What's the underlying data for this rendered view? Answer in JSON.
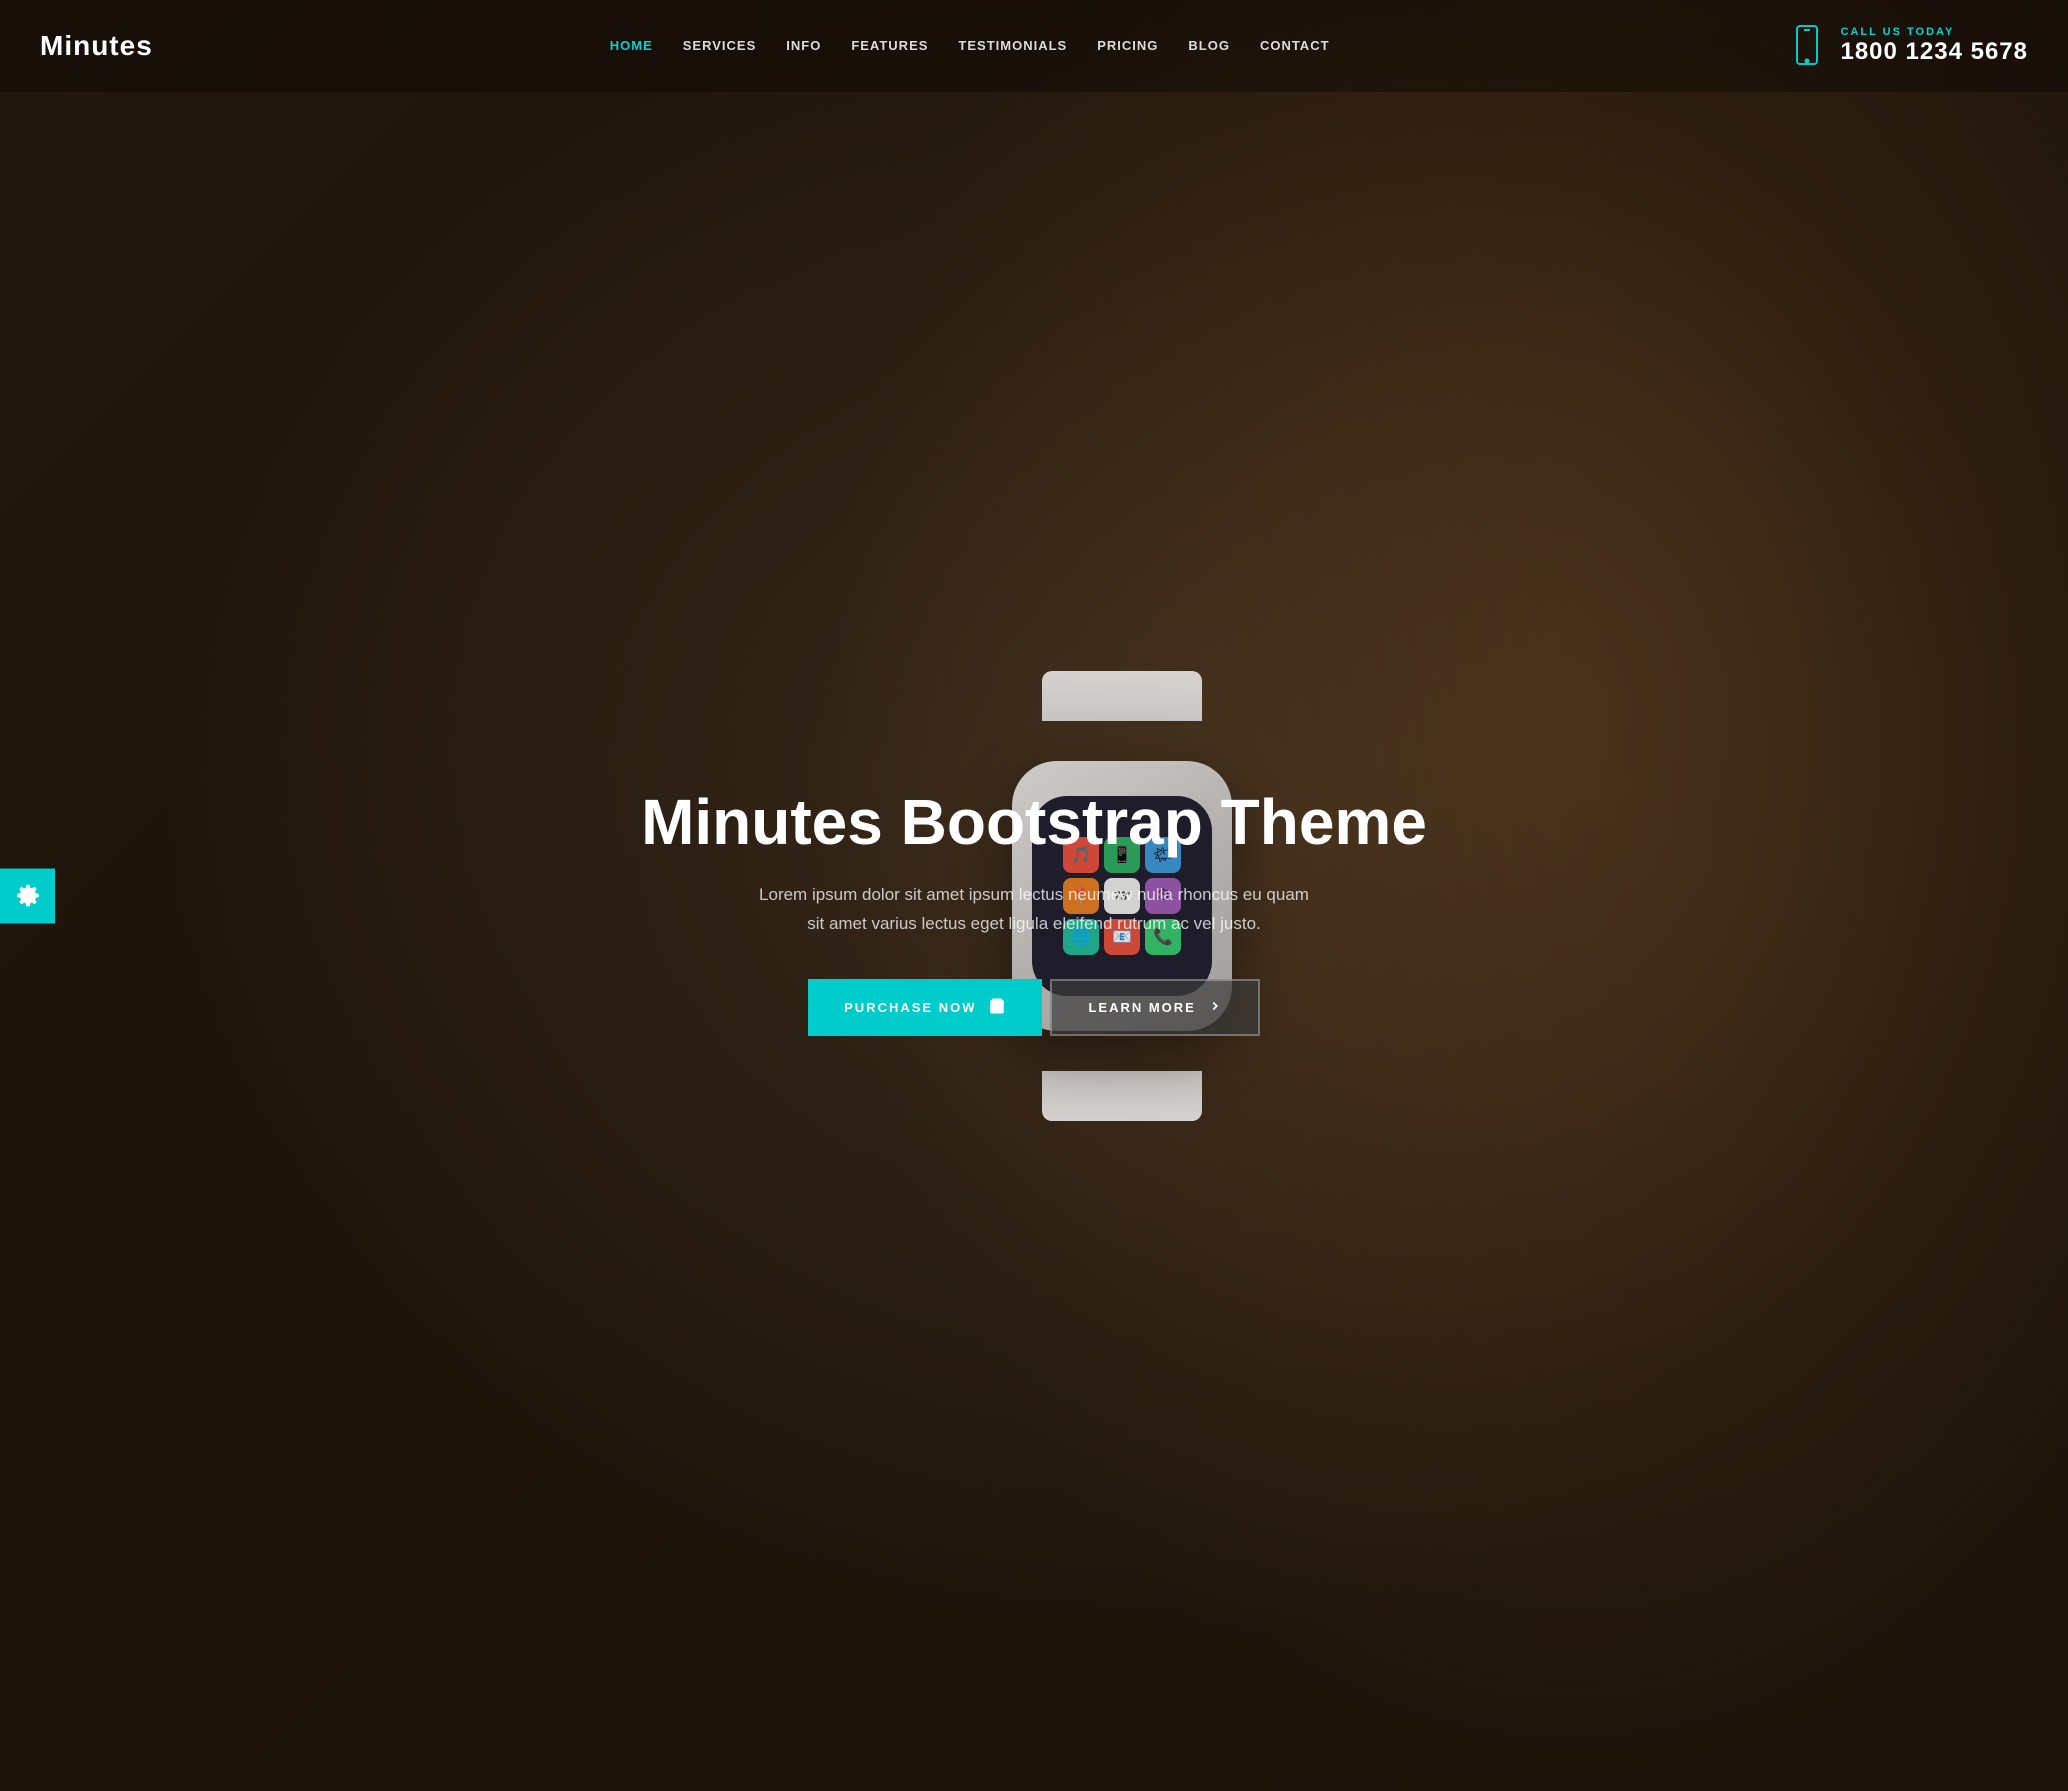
{
  "brand": {
    "name": "Minutes"
  },
  "navbar": {
    "links": [
      {
        "label": "HOME",
        "active": true,
        "href": "#home"
      },
      {
        "label": "SERVICES",
        "active": false,
        "href": "#services"
      },
      {
        "label": "INFO",
        "active": false,
        "href": "#info"
      },
      {
        "label": "FEATURES",
        "active": false,
        "href": "#features"
      },
      {
        "label": "TESTIMONIALS",
        "active": false,
        "href": "#testimonials"
      },
      {
        "label": "PRICING",
        "active": false,
        "href": "#pricing"
      },
      {
        "label": "BLOG",
        "active": false,
        "href": "#blog"
      },
      {
        "label": "CONTACT",
        "active": false,
        "href": "#contact"
      }
    ],
    "call_label": "CALL US TODAY",
    "phone_number": "1800 1234 5678"
  },
  "hero": {
    "title": "Minutes Bootstrap Theme",
    "description": "Lorem ipsum dolor sit amet ipsum lectus neumew nulla rhoncus eu quam sit amet varius lectus eget ligula eleifend rutrum ac vel justo.",
    "btn_purchase": "PURCHASE NOW",
    "btn_learn": "LEARN MORE"
  },
  "settings": {
    "icon": "gear"
  },
  "colors": {
    "accent": "#00cccc",
    "white": "#ffffff",
    "dark": "#1a1a1a"
  },
  "watch": {
    "apps": [
      {
        "color": "#e74c3c",
        "emoji": "🎵"
      },
      {
        "color": "#27ae60",
        "emoji": "📱"
      },
      {
        "color": "#3498db",
        "emoji": "🌤"
      },
      {
        "color": "#e67e22",
        "emoji": "📍"
      },
      {
        "color": "#9b59b6",
        "emoji": "⏱"
      },
      {
        "color": "#1abc9c",
        "emoji": "🌐"
      },
      {
        "color": "#e74c3c",
        "emoji": "📧"
      },
      {
        "color": "#2ecc71",
        "emoji": "📞"
      },
      {
        "color": "#f39c12",
        "emoji": "🏃"
      }
    ]
  }
}
